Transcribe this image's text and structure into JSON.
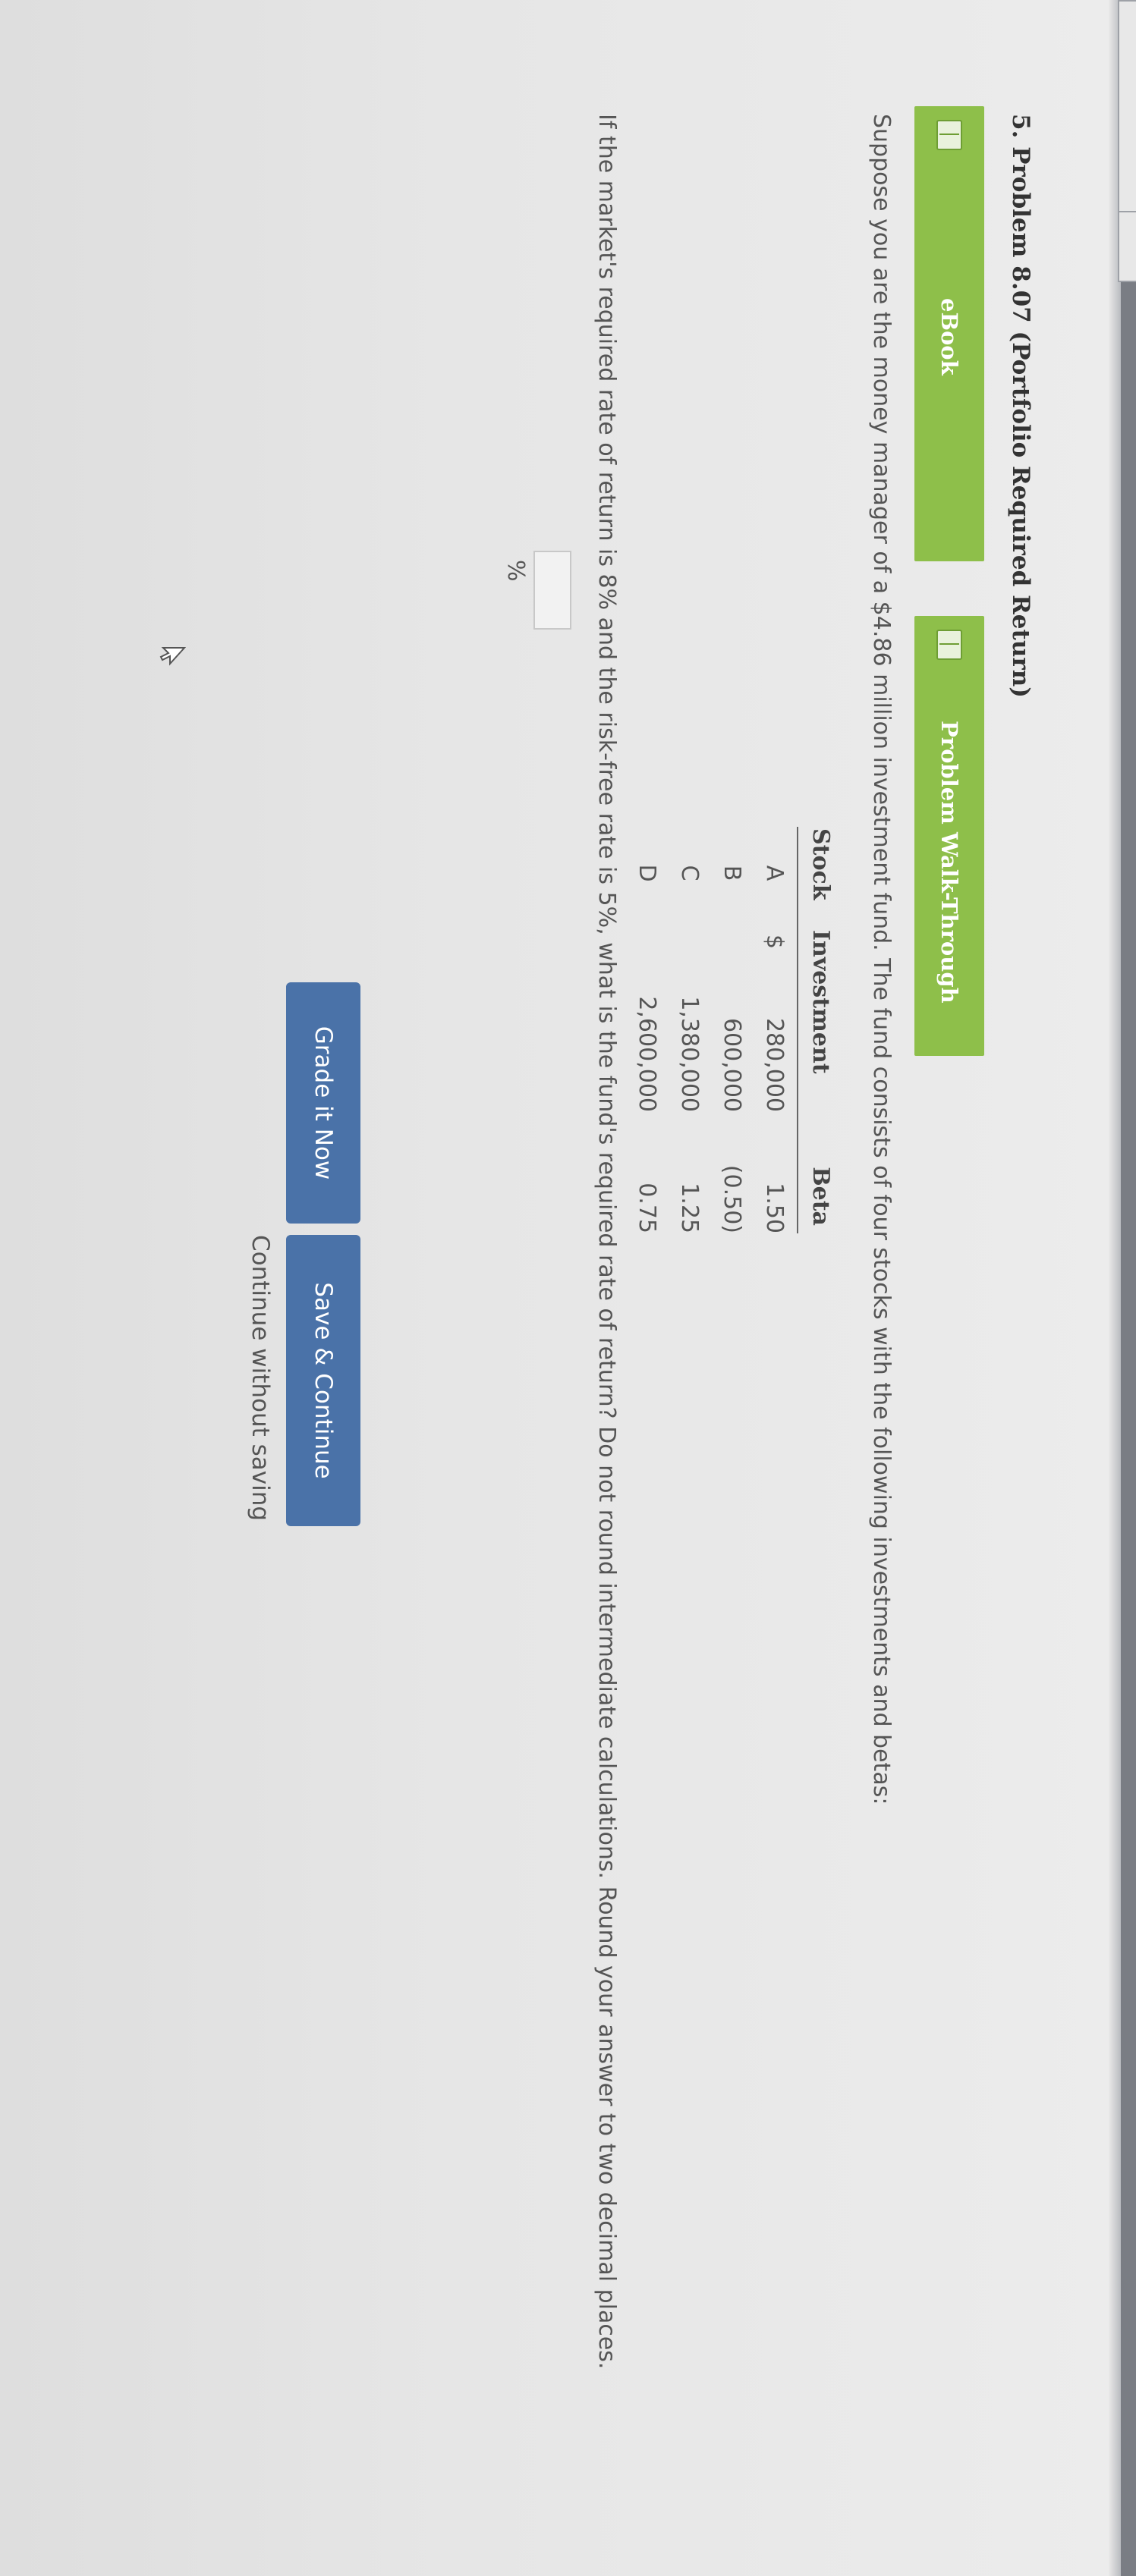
{
  "problem": {
    "title": "5. Problem 8.07 (Portfolio Required Return)"
  },
  "tabs": {
    "ebook_label": "eBook",
    "walkthrough_label": "Problem Walk-Through"
  },
  "question": {
    "intro": "Suppose you are the money manager of a $4.86 million investment fund. The fund consists of four stocks with the following investments and betas:",
    "prompt": "If the market's required rate of return is 8% and the risk-free rate is 5%, what is the fund's required rate of return? Do not round intermediate calculations. Round your answer to two decimal places."
  },
  "table": {
    "headers": {
      "stock": "Stock",
      "investment": "Investment",
      "beta": "Beta"
    },
    "currency_symbol": "$",
    "rows": [
      {
        "stock": "A",
        "investment": "280,000",
        "beta": "1.50"
      },
      {
        "stock": "B",
        "investment": "600,000",
        "beta": "(0.50)"
      },
      {
        "stock": "C",
        "investment": "1,380,000",
        "beta": "1.25"
      },
      {
        "stock": "D",
        "investment": "2,600,000",
        "beta": "0.75"
      }
    ]
  },
  "answer": {
    "value": "",
    "unit": "%"
  },
  "actions": {
    "grade_label": "Grade it Now",
    "save_label": "Save & Continue",
    "continue_label": "Continue without saving"
  },
  "colors": {
    "tab_green": "#8ebf4a",
    "button_blue": "#4a72a8"
  }
}
